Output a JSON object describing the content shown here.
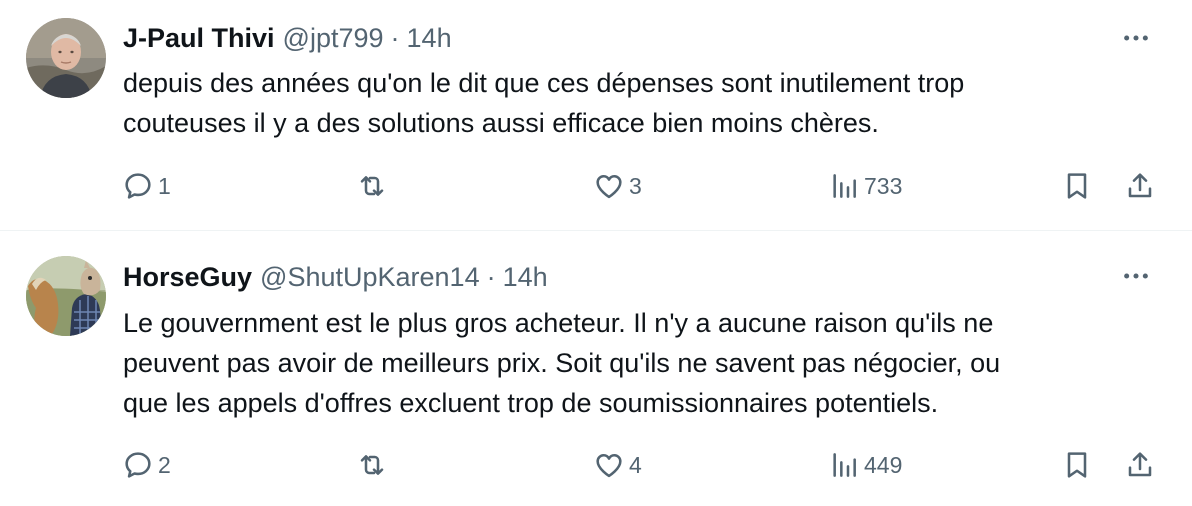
{
  "tweets": [
    {
      "author": {
        "name": "J-Paul Thivi",
        "handle": "@jpt799"
      },
      "separator": "·",
      "time": "14h",
      "text_lines": [
        "depuis des années qu'on le dit que ces dépenses sont  inutilement trop",
        "couteuses il y a des solutions aussi efficace bien moins chères."
      ],
      "stats": {
        "replies": "1",
        "retweets": "",
        "likes": "3",
        "views": "733"
      }
    },
    {
      "author": {
        "name": "HorseGuy",
        "handle": "@ShutUpKaren14"
      },
      "separator": "·",
      "time": "14h",
      "text_lines": [
        "Le gouvernment est le plus gros acheteur. Il n'y a aucune raison qu'ils ne",
        "peuvent pas avoir de meilleurs prix. Soit qu'ils ne savent pas négocier, ou",
        "que les appels d'offres excluent trop de soumissionnaires potentiels."
      ],
      "stats": {
        "replies": "2",
        "retweets": "",
        "likes": "4",
        "views": "449"
      }
    }
  ],
  "icons": {
    "reply": "speech-bubble-icon",
    "retweet": "retweet-arrows-icon",
    "like": "heart-outline-icon",
    "views": "bar-chart-icon",
    "bookmark": "bookmark-icon",
    "share": "share-arrow-icon",
    "more": "three-dots-icon"
  },
  "colors": {
    "text_primary": "#0f1419",
    "text_secondary": "#536471",
    "divider": "#eff3f4"
  }
}
